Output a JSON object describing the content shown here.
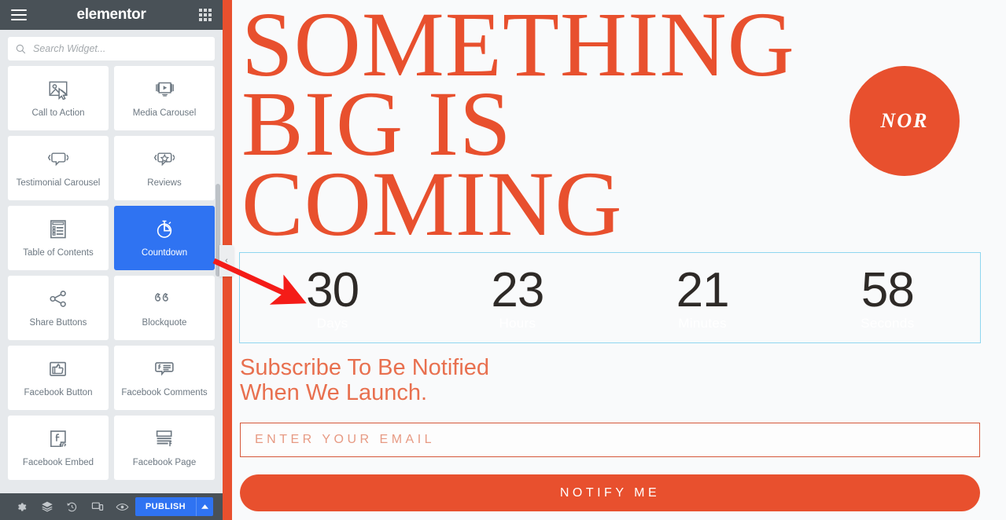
{
  "panel": {
    "brand": "elementor",
    "menu_icon": "hamburger-icon",
    "grid_icon": "apps-grid-icon",
    "search": {
      "placeholder": "Search Widget...",
      "value": "",
      "icon": "search-icon"
    },
    "widgets": [
      {
        "label": "Call to Action",
        "icon": "image-cursor-icon",
        "selected": false
      },
      {
        "label": "Media Carousel",
        "icon": "video-slider-icon",
        "selected": false
      },
      {
        "label": "Testimonial Carousel",
        "icon": "speech-bubble-icon",
        "selected": false
      },
      {
        "label": "Reviews",
        "icon": "star-bubble-icon",
        "selected": false
      },
      {
        "label": "Table of Contents",
        "icon": "list-document-icon",
        "selected": false
      },
      {
        "label": "Countdown",
        "icon": "stopwatch-icon",
        "selected": true
      },
      {
        "label": "Share Buttons",
        "icon": "share-nodes-icon",
        "selected": false
      },
      {
        "label": "Blockquote",
        "icon": "quote-marks-icon",
        "selected": false
      },
      {
        "label": "Facebook Button",
        "icon": "thumbs-up-icon",
        "selected": false
      },
      {
        "label": "Facebook Comments",
        "icon": "fb-comment-icon",
        "selected": false
      },
      {
        "label": "Facebook Embed",
        "icon": "fb-embed-code-icon",
        "selected": false
      },
      {
        "label": "Facebook Page",
        "icon": "fb-page-icon",
        "selected": false
      }
    ],
    "footer": {
      "icons": [
        "settings-gear-icon",
        "navigator-layers-icon",
        "history-clock-icon",
        "responsive-mode-icon",
        "preview-eye-icon"
      ],
      "publish_label": "PUBLISH",
      "publish_caret": "chevron-up-icon"
    },
    "collapse_handle": "‹"
  },
  "canvas": {
    "headline_lines": [
      "SOMETHING",
      "BIG IS",
      "COMING"
    ],
    "badge_text": "NOR",
    "countdown": {
      "items": [
        {
          "value": "30",
          "label": "Days"
        },
        {
          "value": "23",
          "label": "Hours"
        },
        {
          "value": "21",
          "label": "Minutes"
        },
        {
          "value": "58",
          "label": "Seconds"
        }
      ]
    },
    "subscribe_lines": [
      "Subscribe To Be Notified",
      "When We Launch."
    ],
    "email": {
      "placeholder": "ENTER YOUR EMAIL",
      "value": ""
    },
    "notify_label": "NOTIFY ME"
  },
  "colors": {
    "brand_orange": "#e8502e",
    "accent_blue": "#2f73f2",
    "panel_dark": "#495157",
    "selection_border": "#8fd6ef",
    "annotation_red": "#f41c18"
  }
}
